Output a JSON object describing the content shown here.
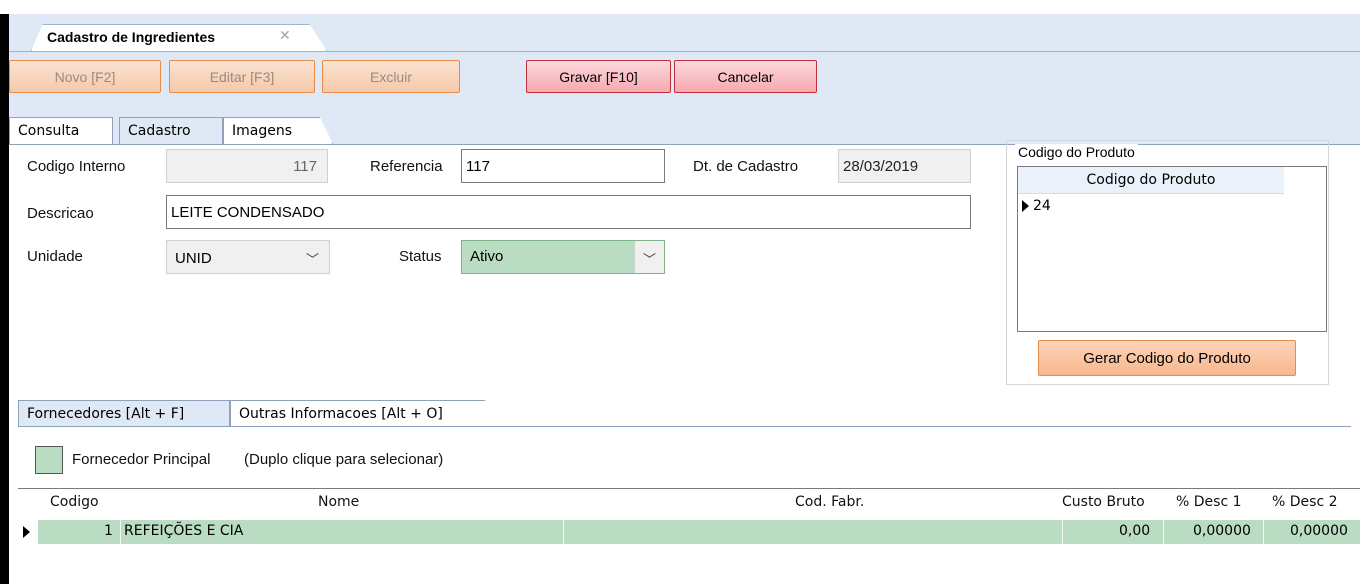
{
  "window": {
    "doc_tab_title": "Cadastro de Ingredientes",
    "doc_tab_close": "✕"
  },
  "toolbar": {
    "novo": "Novo [F2]",
    "editar": "Editar [F3]",
    "excluir": "Excluir",
    "gravar": "Gravar [F10]",
    "cancelar": "Cancelar"
  },
  "tabs": [
    "Consulta",
    "Cadastro",
    "Imagens"
  ],
  "form": {
    "codigo_interno_label": "Codigo Interno",
    "codigo_interno_value": "117",
    "referencia_label": "Referencia",
    "referencia_value": "117",
    "dt_cadastro_label": "Dt. de Cadastro",
    "dt_cadastro_value": "28/03/2019",
    "descricao_label": "Descricao",
    "descricao_value": "LEITE CONDENSADO",
    "unidade_label": "Unidade",
    "unidade_value": "UNID",
    "status_label": "Status",
    "status_value": "Ativo"
  },
  "produto_group": {
    "title": "Codigo do Produto",
    "column_header": "Codigo do Produto",
    "rows": [
      "24"
    ],
    "generate_button": "Gerar Codigo do Produto"
  },
  "subtabs": [
    "Fornecedores [Alt + F]",
    "Outras Informacoes [Alt + O]"
  ],
  "legend": {
    "label": "Fornecedor Principal",
    "hint": "(Duplo clique para selecionar)",
    "color": "#b9dcc2"
  },
  "suppliers_grid": {
    "headers": [
      "Codigo",
      "Nome",
      "Cod. Fabr.",
      "Custo Bruto",
      "% Desc 1",
      "% Desc 2"
    ],
    "rows": [
      {
        "codigo": "1",
        "nome": "REFEIÇÕES E CIA",
        "cod_fabr": "",
        "custo_bruto": "0,00",
        "desc1": "0,00000",
        "desc2": "0,00000"
      }
    ]
  },
  "colors": {
    "accent_orange": "#f7b78e",
    "accent_red": "#f5a9b0",
    "window_bg": "#dfe9f5",
    "highlight_green": "#b9dcc2"
  }
}
